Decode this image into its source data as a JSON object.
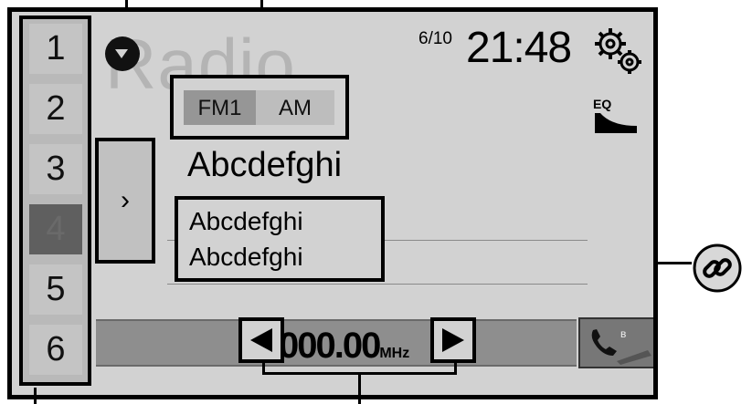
{
  "background_watermark": "Radio",
  "presets": [
    "1",
    "2",
    "3",
    "4",
    "5",
    "6"
  ],
  "selected_preset": "4",
  "bands": [
    "FM1",
    "AM"
  ],
  "date": "6/10",
  "time": "21:48",
  "eq_label": "EQ",
  "station_name": "Abcdefghi",
  "info_lines": [
    "Abcdefghi",
    "Abcdefghi"
  ],
  "frequency": "000.00",
  "frequency_unit": "MHz",
  "icons": {
    "expand": "chevron-right-icon",
    "settings": "gear-icon",
    "equalizer": "eq-icon",
    "prev": "triangle-left-icon",
    "next": "triangle-right-icon",
    "phone": "phone-bluetooth-icon",
    "link": "link-icon"
  }
}
